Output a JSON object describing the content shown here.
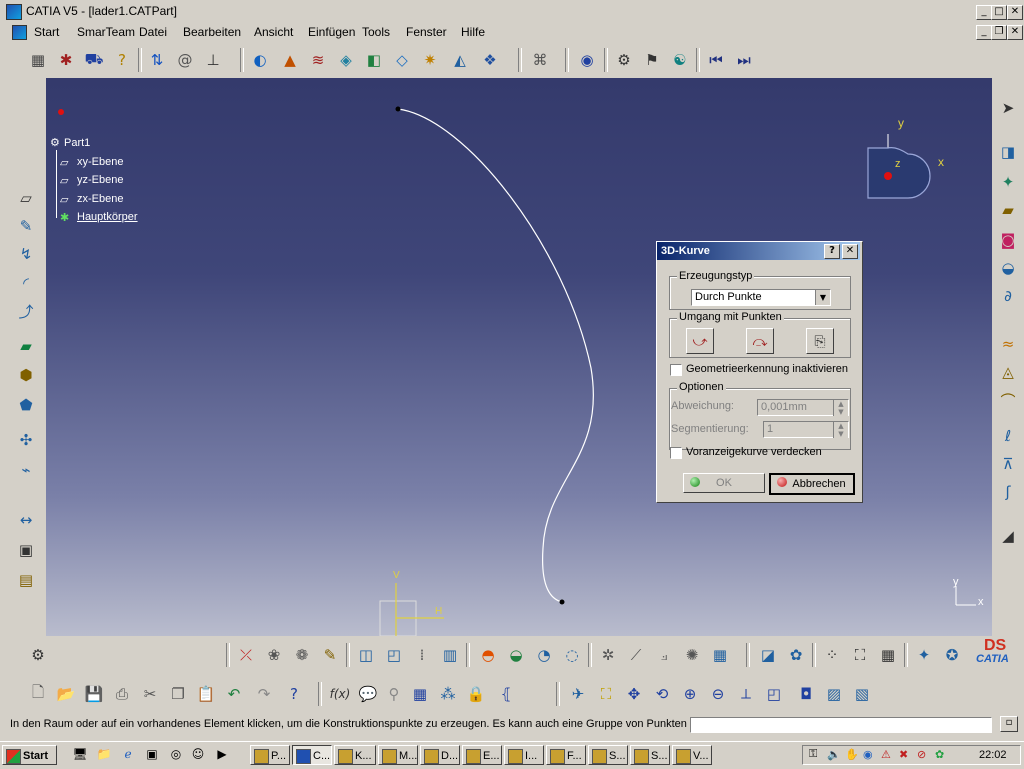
{
  "window": {
    "title": "CATIA V5 - [lader1.CATPart]"
  },
  "menu": [
    {
      "label": "Start"
    },
    {
      "label": "SmarTeam"
    },
    {
      "label": "Datei"
    },
    {
      "label": "Bearbeiten"
    },
    {
      "label": "Ansicht"
    },
    {
      "label": "Einfügen"
    },
    {
      "label": "Tools"
    },
    {
      "label": "Fenster"
    },
    {
      "label": "Hilfe"
    }
  ],
  "tree": {
    "root": "Part1",
    "items": [
      "xy-Ebene",
      "yz-Ebene",
      "zx-Ebene",
      "Hauptkörper"
    ]
  },
  "compass": {
    "x": "x",
    "y": "y",
    "z": "z"
  },
  "axis_small": {
    "x": "x",
    "y": "y"
  },
  "axis_h": {
    "h": "H",
    "v": "V"
  },
  "dialog": {
    "title": "3D-Kurve",
    "help": "?",
    "close": "✕",
    "creation_type_label": "Erzeugungstyp",
    "creation_type_value": "Durch Punkte",
    "points_handling_label": "Umgang mit Punkten",
    "geo_checkbox_label": "Geometrieerkennung inaktivieren",
    "options_label": "Optionen",
    "deviation_label": "Abweichung:",
    "deviation_value": "0,001mm",
    "segmentation_label": "Segmentierung:",
    "segmentation_value": "1",
    "hide_preview_label": "Voranzeigekurve verdecken",
    "ok": "OK",
    "cancel": "Abbrechen"
  },
  "status": {
    "message": "In den Raum oder auf ein vorhandenes Element klicken, um die Konstruktionspunkte zu erzeugen. Es kann auch eine Gruppe von Punkten im S"
  },
  "taskbar": {
    "start": "Start",
    "tasks": [
      "P...",
      "C...",
      "K...",
      "M...",
      "D...",
      "E...",
      "I...",
      "F...",
      "S...",
      "S...",
      "V..."
    ],
    "clock": "22:02"
  },
  "logo": {
    "text": "CATIA"
  }
}
